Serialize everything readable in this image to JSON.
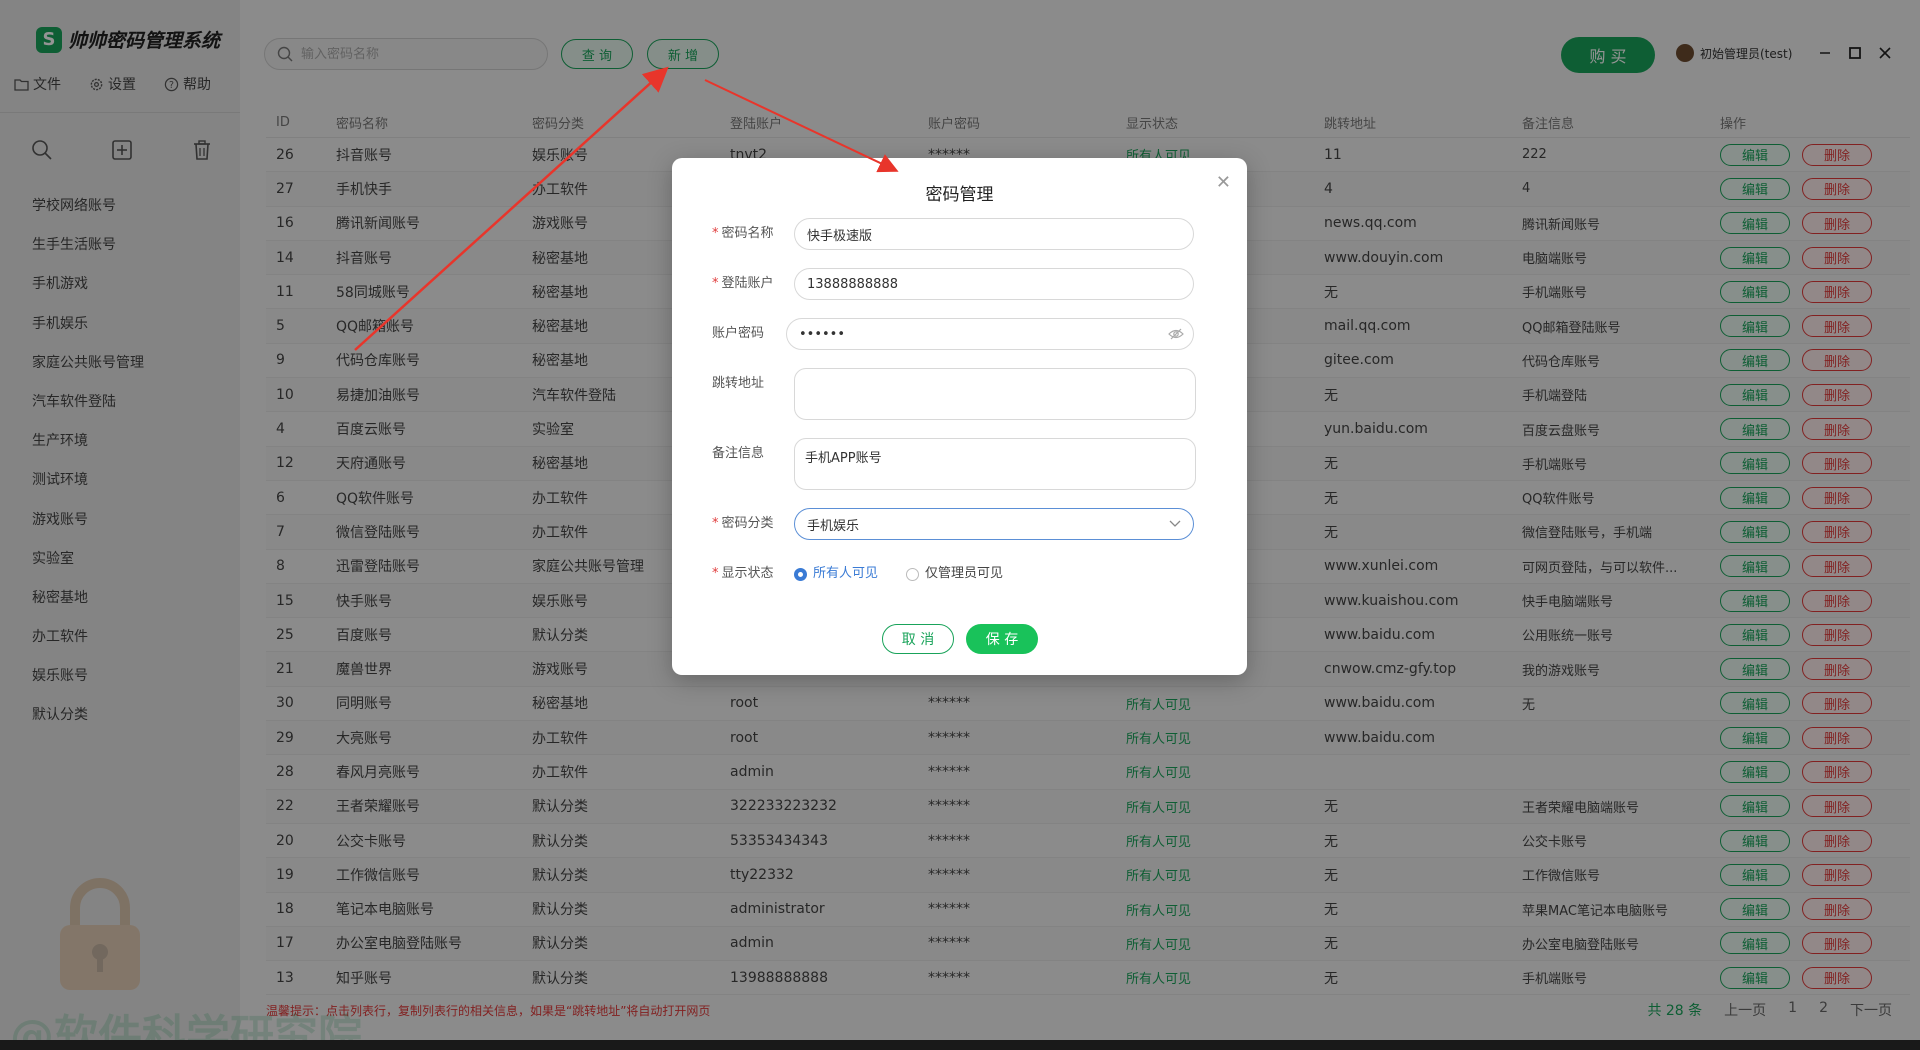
{
  "app": {
    "title": "帅帅密码管理系统",
    "logo_letter": "S"
  },
  "menubar": {
    "file": "文件",
    "settings": "设置",
    "help": "帮助"
  },
  "categories": [
    "学校网络账号",
    "生手生活账号",
    "手机游戏",
    "手机娱乐",
    "家庭公共账号管理",
    "汽车软件登陆",
    "生产环境",
    "测试环境",
    "游戏账号",
    "实验室",
    "秘密基地",
    "办工软件",
    "娱乐账号",
    "默认分类"
  ],
  "search": {
    "placeholder": "输入密码名称"
  },
  "toolbar": {
    "query": "查 询",
    "add": "新 增",
    "buy": "购 买"
  },
  "user": {
    "name": "初始管理员(test)"
  },
  "table": {
    "headers": [
      "ID",
      "密码名称",
      "密码分类",
      "登陆账户",
      "账户密码",
      "显示状态",
      "跳转地址",
      "备注信息",
      "操作"
    ],
    "edit_label": "编辑",
    "delete_label": "删除",
    "rows": [
      [
        "26",
        "抖音账号",
        "娱乐账号",
        "tnvt2",
        "******",
        "所有人可见",
        "11",
        "222"
      ],
      [
        "27",
        "手机快手",
        "办工软件",
        "",
        "",
        "",
        "4",
        "4"
      ],
      [
        "16",
        "腾讯新闻账号",
        "游戏账号",
        "",
        "",
        "",
        "news.qq.com",
        "腾讯新闻账号"
      ],
      [
        "14",
        "抖音账号",
        "秘密基地",
        "",
        "",
        "",
        "www.douyin.com",
        "电脑端账号"
      ],
      [
        "11",
        "58同城账号",
        "秘密基地",
        "",
        "",
        "",
        "无",
        "手机端账号"
      ],
      [
        "5",
        "QQ邮箱账号",
        "秘密基地",
        "",
        "",
        "",
        "mail.qq.com",
        "QQ邮箱登陆账号"
      ],
      [
        "9",
        "代码仓库账号",
        "秘密基地",
        "",
        "",
        "",
        "gitee.com",
        "代码仓库账号"
      ],
      [
        "10",
        "易捷加油账号",
        "汽车软件登陆",
        "",
        "",
        "",
        "无",
        "手机端登陆"
      ],
      [
        "4",
        "百度云账号",
        "实验室",
        "",
        "",
        "",
        "yun.baidu.com",
        "百度云盘账号"
      ],
      [
        "12",
        "天府通账号",
        "秘密基地",
        "",
        "",
        "",
        "无",
        "手机端账号"
      ],
      [
        "6",
        "QQ软件账号",
        "办工软件",
        "",
        "",
        "",
        "无",
        "QQ软件账号"
      ],
      [
        "7",
        "微信登陆账号",
        "办工软件",
        "",
        "",
        "",
        "无",
        "微信登陆账号，手机端"
      ],
      [
        "8",
        "迅雷登陆账号",
        "家庭公共账号管理",
        "",
        "",
        "",
        "www.xunlei.com",
        "可网页登陆，与可以软件..."
      ],
      [
        "15",
        "快手账号",
        "娱乐账号",
        "",
        "",
        "",
        "www.kuaishou.com",
        "快手电脑端账号"
      ],
      [
        "25",
        "百度账号",
        "默认分类",
        "",
        "",
        "",
        "www.baidu.com",
        "公用账统一账号"
      ],
      [
        "21",
        "魔兽世界",
        "游戏账号",
        "",
        "",
        "",
        "cnwow.cmz-gfy.top",
        "我的游戏账号"
      ],
      [
        "30",
        "同明账号",
        "秘密基地",
        "root",
        "******",
        "所有人可见",
        "www.baidu.com",
        "无"
      ],
      [
        "29",
        "大亮账号",
        "办工软件",
        "root",
        "******",
        "所有人可见",
        "www.baidu.com",
        ""
      ],
      [
        "28",
        "春风月亮账号",
        "办工软件",
        "admin",
        "******",
        "所有人可见",
        "",
        ""
      ],
      [
        "22",
        "王者荣耀账号",
        "默认分类",
        "322233223232",
        "******",
        "所有人可见",
        "无",
        "王者荣耀电脑端账号"
      ],
      [
        "20",
        "公交卡账号",
        "默认分类",
        "53353434343",
        "******",
        "所有人可见",
        "无",
        "公交卡账号"
      ],
      [
        "19",
        "工作微信账号",
        "默认分类",
        "tty22332",
        "******",
        "所有人可见",
        "无",
        "工作微信账号"
      ],
      [
        "18",
        "笔记本电脑账号",
        "默认分类",
        "administrator",
        "******",
        "所有人可见",
        "无",
        "苹果MAC笔记本电脑账号"
      ],
      [
        "17",
        "办公室电脑登陆账号",
        "默认分类",
        "admin",
        "******",
        "所有人可见",
        "无",
        "办公室电脑登陆账号"
      ],
      [
        "13",
        "知乎账号",
        "默认分类",
        "13988888888",
        "******",
        "所有人可见",
        "无",
        "手机端账号"
      ]
    ]
  },
  "footer": {
    "hint": "温馨提示：点击列表行，复制列表行的相关信息，如果是“跳转地址”将自动打开网页",
    "total": "共 28 条",
    "prev": "上一页",
    "page1": "1",
    "page2": "2",
    "next": "下一页"
  },
  "watermark": {
    "left": "@软件科学研究院"
  },
  "modal": {
    "title": "密码管理",
    "fields": {
      "name_label": "密码名称",
      "name_value": "快手极速版",
      "account_label": "登陆账户",
      "account_value": "13888888888",
      "password_label": "账户密码",
      "password_value": "••••••",
      "url_label": "跳转地址",
      "url_value": "",
      "note_label": "备注信息",
      "note_value": "手机APP账号",
      "category_label": "密码分类",
      "category_value": "手机娱乐",
      "status_label": "显示状态",
      "status_option_all": "所有人可见",
      "status_option_admin": "仅管理员可见"
    },
    "cancel": "取 消",
    "save": "保 存"
  },
  "colors": {
    "accent": "#19a35a",
    "danger": "#e03a3a",
    "annotation": "#e8352b",
    "radio": "#3a7bd5"
  }
}
